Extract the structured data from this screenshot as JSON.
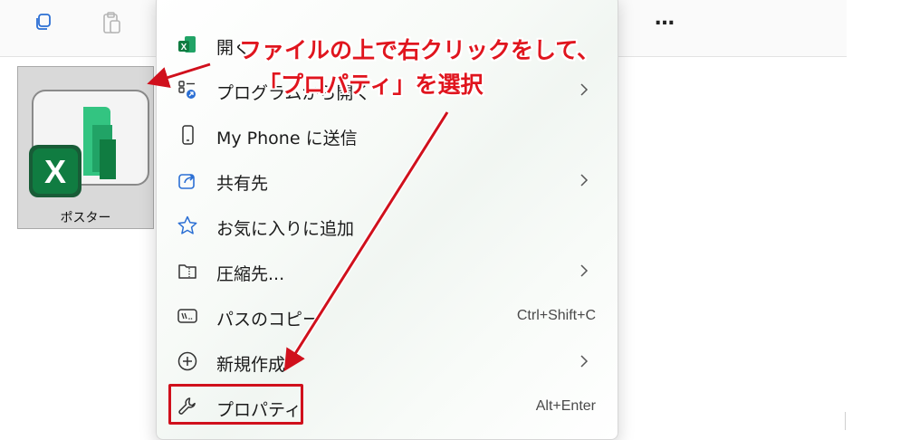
{
  "toolbar": {
    "more_label": "…",
    "icons": [
      "copy-icon",
      "paste-icon",
      "more-icon"
    ]
  },
  "file": {
    "name": "ポスター",
    "icon": "excel-file-icon"
  },
  "context_menu": {
    "items": [
      {
        "label": "開く",
        "icon": "excel-app-icon",
        "submenu": false,
        "shortcut": ""
      },
      {
        "label": "プログラムから開く",
        "icon": "open-with-icon",
        "submenu": true,
        "shortcut": ""
      },
      {
        "label": "My Phone に送信",
        "icon": "phone-icon",
        "submenu": false,
        "shortcut": ""
      },
      {
        "label": "共有先",
        "icon": "share-icon",
        "submenu": true,
        "shortcut": ""
      },
      {
        "label": "お気に入りに追加",
        "icon": "star-icon",
        "submenu": false,
        "shortcut": ""
      },
      {
        "label": "圧縮先...",
        "icon": "zip-folder-icon",
        "submenu": true,
        "shortcut": ""
      },
      {
        "label": "パスのコピー",
        "icon": "copy-path-icon",
        "submenu": false,
        "shortcut": "Ctrl+Shift+C"
      },
      {
        "label": "新規作成",
        "icon": "new-plus-icon",
        "submenu": true,
        "shortcut": ""
      },
      {
        "label": "プロパティ",
        "icon": "wrench-icon",
        "submenu": false,
        "shortcut": "Alt+Enter"
      }
    ]
  },
  "annotation": {
    "line1": "ファイルの上で右クリックをして、",
    "line2": "「プロパティ」を選択",
    "color": "#e0151e"
  }
}
